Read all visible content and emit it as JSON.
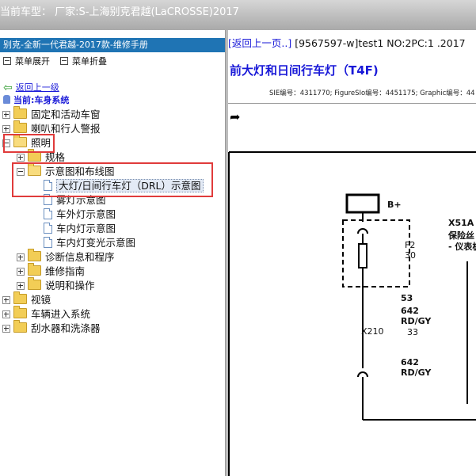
{
  "window": {
    "title": "当前车型： 厂家:S-上海别克君越(LaCROSSE)2017"
  },
  "left_panel": {
    "manual_title": "别克-全新一代君越-2017款-维修手册",
    "expand_all": "菜单展开",
    "collapse_all": "菜单折叠",
    "back_link": "返回上一级",
    "current_system": "当前:车身系统",
    "tree": {
      "fixed_windows": "固定和活动车窗",
      "horn": "喇叭和行人警报",
      "lighting": "照明",
      "spec": "规格",
      "schematics": "示意图和布线图",
      "headlamp_drl": "大灯/日间行车灯（DRL）示意图",
      "fog_lamp": "雾灯示意图",
      "exterior_lamp": "车外灯示意图",
      "interior_lamp": "车内灯示意图",
      "interior_dimming": "车内灯变光示意图",
      "diag_info": "诊断信息和程序",
      "repair_guide": "维修指南",
      "desc_ops": "说明和操作",
      "mirrors": "视镜",
      "vehicle_access": "车辆进入系统",
      "wipers": "刮水器和洗涤器"
    }
  },
  "right_panel": {
    "back_link": "[返回上一页..]",
    "doc_info": "[9567597-w]test1 NO:2PC:1 .2017",
    "doc_title": "前大灯和日间行车灯（T4F)",
    "meta": "SIE编号：4311770; FigureSIo编号：4451175; Graphic编号：44",
    "diagram": {
      "supply": "B+",
      "fuse_id": "F2",
      "fuse_rating": "30",
      "connector_right": "X51A",
      "fuse_block_name": "保险丝",
      "fuse_block_sub": "- 仪表板",
      "pin_53": "53",
      "wire1_num": "642",
      "wire1_color": "RD/GY",
      "connector_inline": "X210",
      "pin_33": "33",
      "wire2_num": "642",
      "wire2_color": "RD/GY"
    }
  },
  "colors": {
    "title_bar": "#b5b5b5",
    "manual_header": "#1f74b4",
    "link_blue": "#1a1ad8",
    "highlight_red": "#e03b3b",
    "folder_yellow": "#f2cd56"
  }
}
